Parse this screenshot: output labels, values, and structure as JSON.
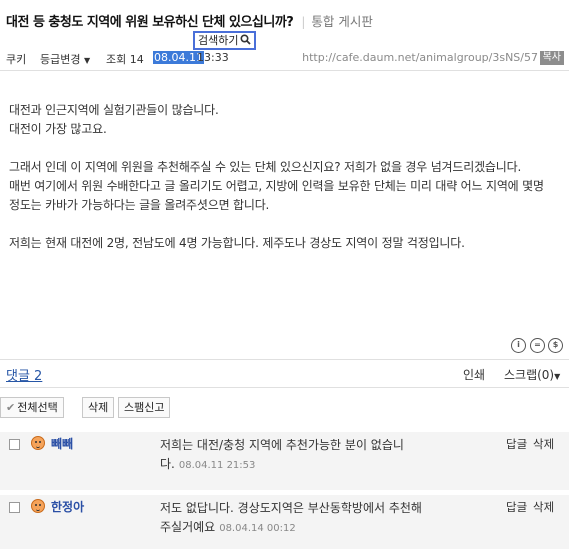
{
  "post": {
    "title": "대전 등 충청도 지역에 위원 보유하신 단체 있으십니까?",
    "board_name": "통합 게시판"
  },
  "search": {
    "label": "검색하기",
    "icon": "search-icon"
  },
  "meta": {
    "cookie_label": "쿠키",
    "grade_label": "등급변경",
    "views_label": "조회 14",
    "date": "08.04.11",
    "time": "13:33",
    "url": "http://cafe.daum.net/animalgroup/3sNS/57",
    "copy_label": "복사"
  },
  "body": {
    "lines": [
      "대전과 인근지역에 실험기관들이 많습니다.",
      "대전이 가장 많고요.",
      "",
      "그래서 인데 이 지역에 위원을 추천해주실 수 있는 단체 있으신지요? 저희가 없을 경우 넘겨드리겠습니다.",
      "매번 여기에서 위원 수배한다고 글 올리기도 어렵고, 지방에 인력을 보유한 단체는 미리 대략 어느 지역에 몇명 정도는 카바가 가능하다는 글을 올려주셧으면 합니다.",
      "",
      "저희는 현재 대전에 2명, 전남도에 4명 가능합니다. 제주도나 경상도 지역이 정말 걱정입니다."
    ]
  },
  "license": {
    "icons": [
      "cc-by-icon",
      "cc-nd-icon",
      "cc-nc-icon"
    ],
    "glyphs": [
      "i",
      "=",
      "$"
    ]
  },
  "replies": {
    "count_label": "댓글 2",
    "print_label": "인쇄",
    "scrap_label": "스크랩(0)"
  },
  "toolbar": {
    "select_all_label": "전체선택",
    "delete_label": "삭제",
    "spam_label": "스팸신고"
  },
  "comments": [
    {
      "author": "빼빼",
      "text": "저희는 대전/충청 지역에 추천가능한 분이 없습니다.",
      "date": "08.04.11 21:53",
      "reply_label": "답글",
      "delete_label": "삭제"
    },
    {
      "author": "한정아",
      "text": "저도 없답니다. 경상도지역은 부산동학방에서 추천해주실거예요",
      "date": "08.04.14 00:12",
      "reply_label": "답글",
      "delete_label": "삭제"
    }
  ]
}
